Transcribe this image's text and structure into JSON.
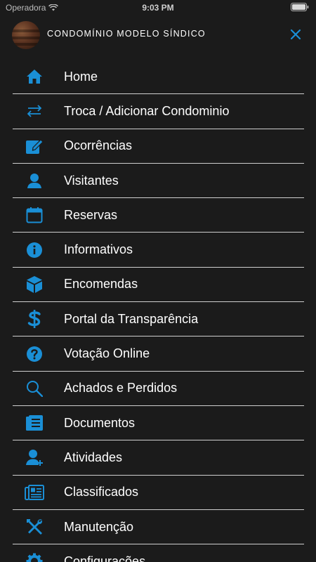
{
  "status_bar": {
    "carrier": "Operadora",
    "time": "9:03 PM"
  },
  "header": {
    "title": "CONDOMÍNIO MODELO SÍNDICO"
  },
  "colors": {
    "accent": "#1a8fd6",
    "background": "#1b1b1b",
    "divider": "#cfcfcf"
  },
  "menu": {
    "items": [
      {
        "label": "Home",
        "icon": "home-icon"
      },
      {
        "label": "Troca / Adicionar Condominio",
        "icon": "swap-arrows-icon"
      },
      {
        "label": "Ocorrências",
        "icon": "edit-icon"
      },
      {
        "label": "Visitantes",
        "icon": "person-icon"
      },
      {
        "label": "Reservas",
        "icon": "calendar-icon"
      },
      {
        "label": "Informativos",
        "icon": "info-icon"
      },
      {
        "label": "Encomendas",
        "icon": "package-icon"
      },
      {
        "label": "Portal da Transparência",
        "icon": "dollar-icon"
      },
      {
        "label": "Votação Online",
        "icon": "question-icon"
      },
      {
        "label": "Achados e Perdidos",
        "icon": "search-icon"
      },
      {
        "label": "Documentos",
        "icon": "document-icon"
      },
      {
        "label": "Atividades",
        "icon": "person-add-icon"
      },
      {
        "label": "Classificados",
        "icon": "newspaper-icon"
      },
      {
        "label": "Manutenção",
        "icon": "tools-icon"
      },
      {
        "label": "Configurações",
        "icon": "gear-icon"
      }
    ]
  }
}
